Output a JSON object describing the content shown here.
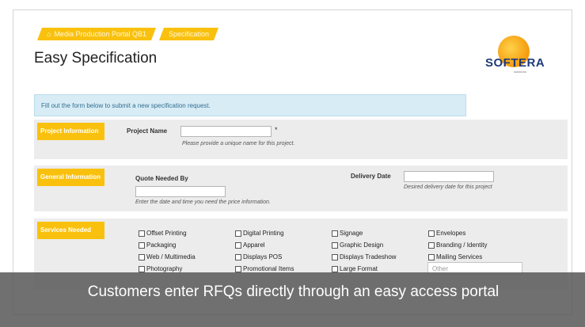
{
  "breadcrumb": {
    "items": [
      {
        "label": "Media Production Portal QB1",
        "icon": "home-icon"
      },
      {
        "label": "Specification"
      }
    ]
  },
  "page": {
    "title": "Easy Specification"
  },
  "logo": {
    "brand": "SOFTERA",
    "tagline": "solutions"
  },
  "info_banner": "Fill out the form below to submit a new specification request.",
  "sections": {
    "project": {
      "label": "Project Information",
      "name_label": "Project Name",
      "name_value": "",
      "required_mark": "*",
      "name_hint": "Please provide a unique name for this project."
    },
    "general": {
      "label": "General Information",
      "quote_label": "Quote Needed By",
      "quote_value": "",
      "quote_hint": "Enter the date and time you need the price information.",
      "delivery_label": "Delivery Date",
      "delivery_value": "",
      "delivery_hint": "Desired delivery date for this project"
    },
    "services": {
      "label": "Services Needed",
      "items": [
        "Offset Printing",
        "Digital Printing",
        "Signage",
        "Envelopes",
        "Packaging",
        "Apparel",
        "Graphic Design",
        "Branding / Identity",
        "Web / Multimedia",
        "Displays POS",
        "Displays Tradeshow",
        "Mailing Services",
        "Photography",
        "Promotional Items",
        "Large Format"
      ],
      "other_placeholder": "Other"
    }
  },
  "caption": "Customers enter RFQs directly through an easy access portal",
  "colors": {
    "accent": "#f9c10e",
    "info_bg": "#d8ecf6",
    "section_bg": "#ececec",
    "caption_bg": "#585858"
  }
}
